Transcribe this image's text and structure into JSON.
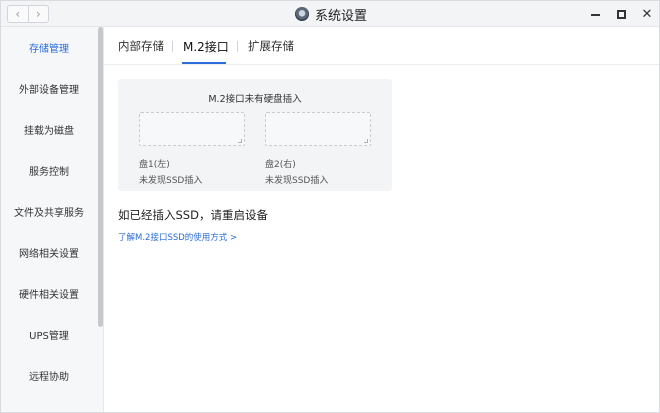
{
  "window": {
    "title": "系统设置",
    "nav_back": "‹",
    "nav_forward": "›",
    "close_glyph": "✕"
  },
  "sidebar": {
    "items": [
      {
        "label": "存储管理",
        "active": true
      },
      {
        "label": "外部设备管理"
      },
      {
        "label": "挂载为磁盘"
      },
      {
        "label": "服务控制"
      },
      {
        "label": "文件及共享服务"
      },
      {
        "label": "网络相关设置"
      },
      {
        "label": "硬件相关设置"
      },
      {
        "label": "UPS管理"
      },
      {
        "label": "远程协助"
      }
    ]
  },
  "tabs": [
    {
      "label": "内部存储"
    },
    {
      "label": "M.2接口",
      "active": true
    },
    {
      "label": "扩展存储"
    }
  ],
  "m2": {
    "panel_title": "M.2接口未有硬盘插入",
    "slots": [
      {
        "name": "盘1(左)",
        "status": "未发现SSD插入"
      },
      {
        "name": "盘2(右)",
        "status": "未发现SSD插入"
      }
    ],
    "notice": "如已经插入SSD，请重启设备",
    "learn_link": "了解M.2接口SSD的使用方式 >"
  },
  "colors": {
    "accent": "#2a6cd9",
    "panel_bg": "#f3f4f6"
  }
}
